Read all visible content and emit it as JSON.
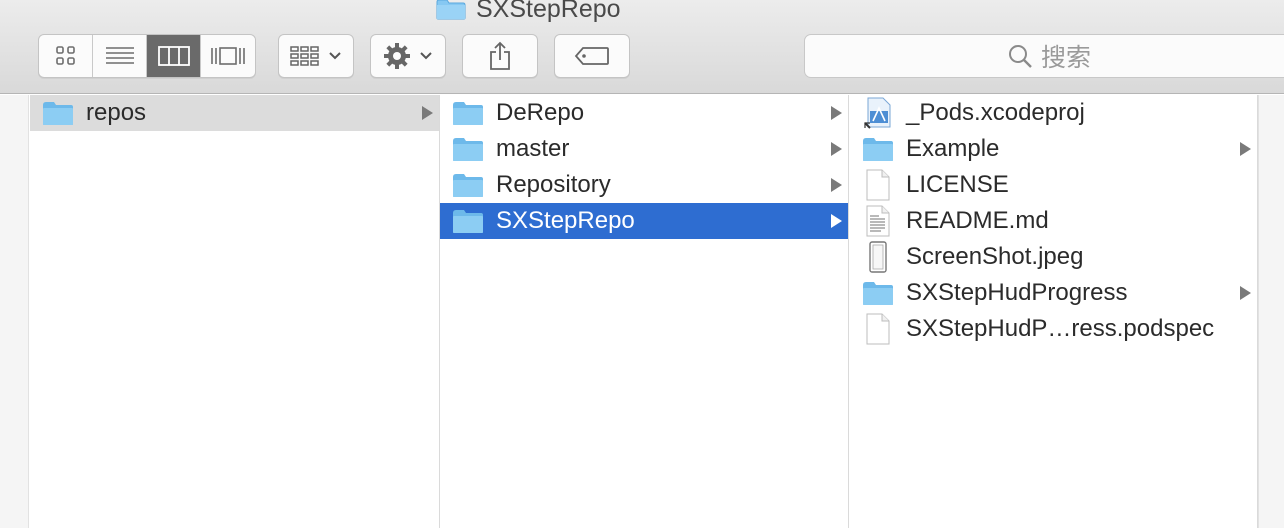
{
  "window": {
    "title": "SXStepRepo"
  },
  "toolbar": {
    "view_modes": [
      {
        "name": "icon-view",
        "active": false
      },
      {
        "name": "list-view",
        "active": false
      },
      {
        "name": "column-view",
        "active": true
      },
      {
        "name": "cover-flow-view",
        "active": false
      }
    ],
    "search_placeholder": "搜索"
  },
  "columns": [
    {
      "items": [
        {
          "label": "repos",
          "icon": "folder-icon",
          "has_children": true,
          "selected": "inactive"
        }
      ]
    },
    {
      "items": [
        {
          "label": "DeRepo",
          "icon": "folder-icon",
          "has_children": true,
          "selected": "none"
        },
        {
          "label": "master",
          "icon": "folder-icon",
          "has_children": true,
          "selected": "none"
        },
        {
          "label": "Repository",
          "icon": "folder-icon",
          "has_children": true,
          "selected": "none"
        },
        {
          "label": "SXStepRepo",
          "icon": "folder-icon",
          "has_children": true,
          "selected": "active"
        }
      ]
    },
    {
      "items": [
        {
          "label": "_Pods.xcodeproj",
          "icon": "xcode-project-icon",
          "has_children": false
        },
        {
          "label": "Example",
          "icon": "folder-icon",
          "has_children": true
        },
        {
          "label": "LICENSE",
          "icon": "document-icon",
          "has_children": false
        },
        {
          "label": "README.md",
          "icon": "text-document-icon",
          "has_children": false
        },
        {
          "label": "ScreenShot.jpeg",
          "icon": "image-file-icon",
          "has_children": false
        },
        {
          "label": "SXStepHudProgress",
          "icon": "folder-icon",
          "has_children": true
        },
        {
          "label": "SXStepHudP…ress.podspec",
          "icon": "document-icon",
          "has_children": false
        }
      ]
    }
  ],
  "colors": {
    "selection_active": "#2e6dd1",
    "selection_inactive": "#dcdcdc",
    "folder": "#7cc4f2"
  }
}
